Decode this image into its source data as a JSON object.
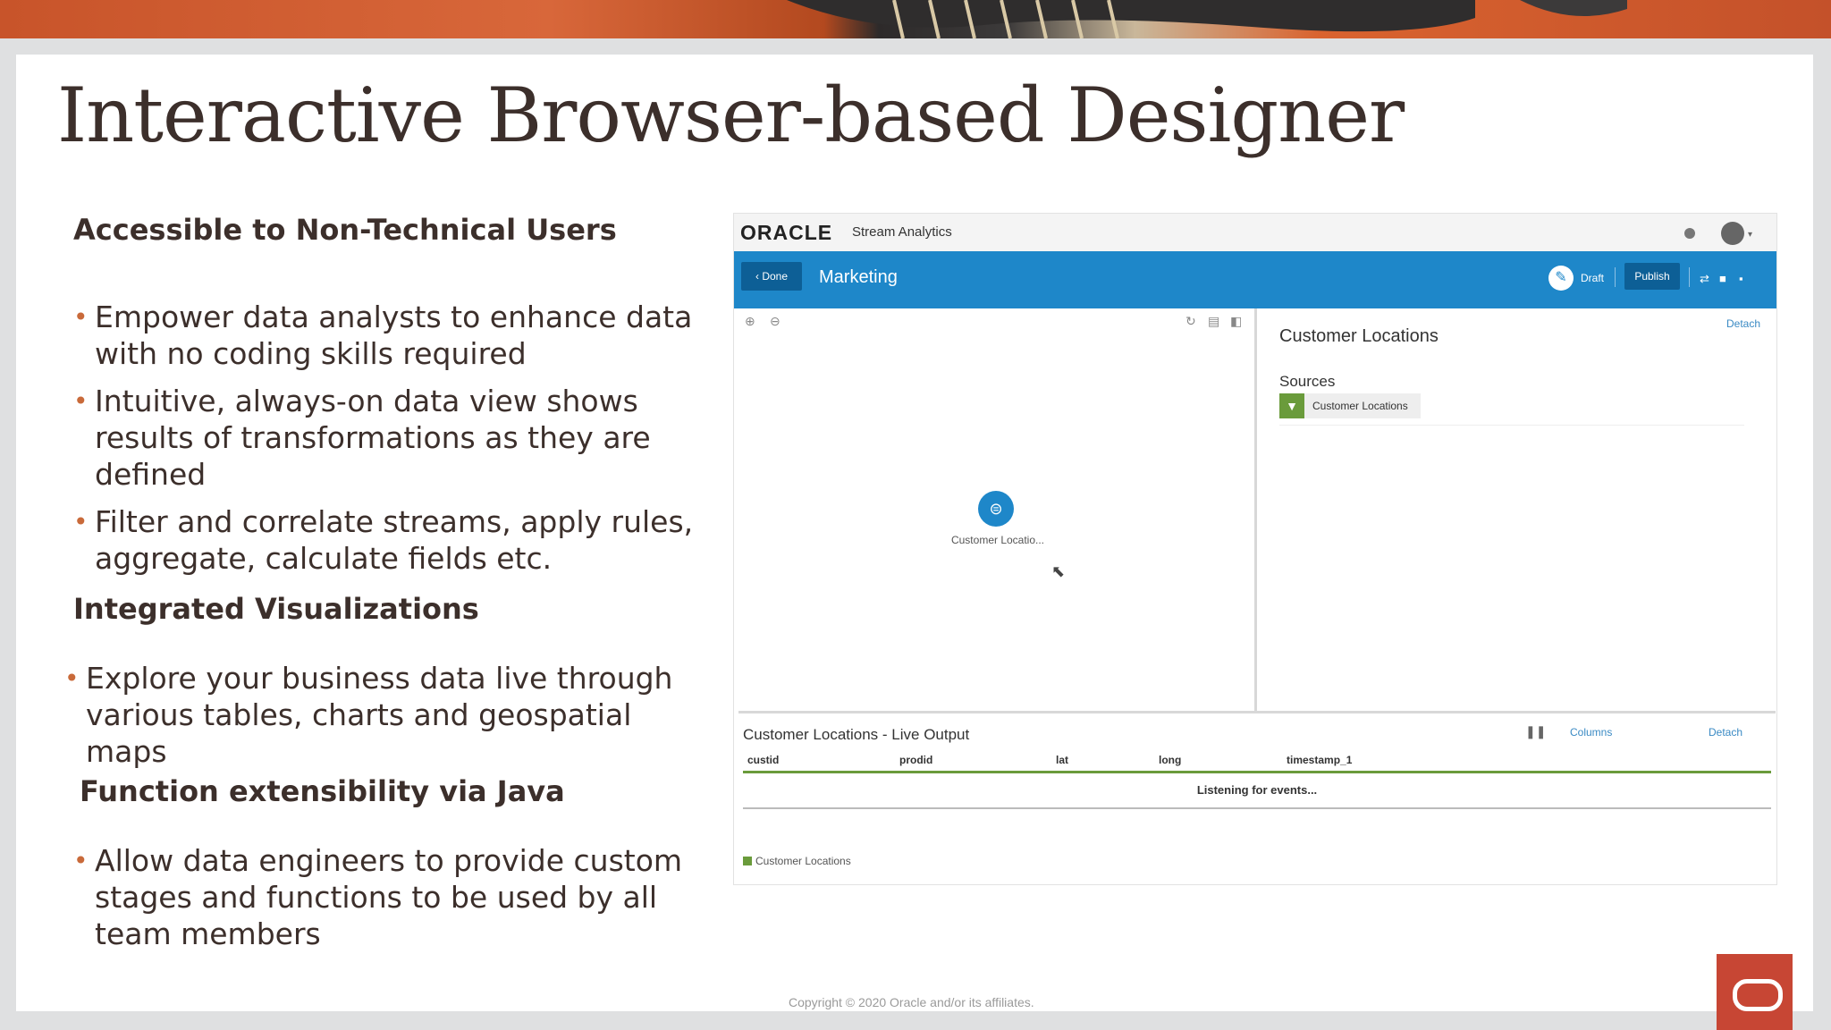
{
  "slide": {
    "title": "Interactive Browser-based Designer",
    "sections": [
      {
        "heading": "Accessible to Non-Technical Users",
        "bullets": [
          "Empower data analysts to enhance data with no coding skills required",
          "Intuitive, always-on data view shows results of transformations as they are defined",
          "Filter and correlate streams, apply rules, aggregate, calculate fields etc."
        ]
      },
      {
        "heading": "Integrated Visualizations",
        "bullets": [
          "Explore your business data live through various tables, charts and geospatial maps"
        ]
      },
      {
        "heading": "Function extensibility via Java",
        "bullets": [
          "Allow data engineers to provide custom stages and functions to be used by all team members"
        ]
      }
    ],
    "copyright": "Copyright © 2020 Oracle and/or its affiliates."
  },
  "app": {
    "brand": "ORACLE",
    "product": "Stream Analytics",
    "toolbar": {
      "done_label": "Done",
      "pipeline_name": "Marketing",
      "draft_label": "Draft",
      "publish_label": "Publish"
    },
    "canvas": {
      "node_label": "Customer Locatio..."
    },
    "properties": {
      "title": "Customer Locations",
      "detach_label": "Detach",
      "sources_label": "Sources",
      "source_item": "Customer Locations"
    },
    "output": {
      "title": "Customer Locations - Live Output",
      "columns_label": "Columns",
      "detach_label": "Detach",
      "columns": [
        "custid",
        "prodid",
        "lat",
        "long",
        "timestamp_1"
      ],
      "status": "Listening for events...",
      "legend": "Customer Locations"
    }
  },
  "colors": {
    "oracle_red": "#c74634",
    "toolbar_blue": "#1e87c9",
    "accent_green": "#6a9b3b"
  }
}
